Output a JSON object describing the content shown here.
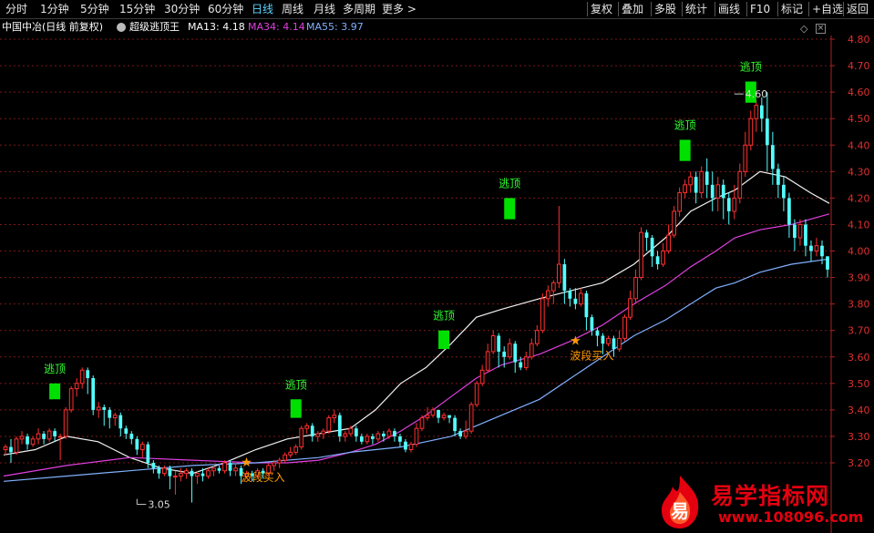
{
  "toolbar": {
    "left": [
      "分时",
      "1分钟",
      "5分钟",
      "15分钟",
      "30分钟",
      "60分钟",
      "日线",
      "周线",
      "月线",
      "多周期",
      "更多 >"
    ],
    "active": "日线",
    "right": [
      "复权",
      "叠加",
      "多股",
      "统计",
      "画线",
      "F10",
      "标记",
      "+自选",
      "返回"
    ]
  },
  "info": {
    "title": "中国中冶(日线 前复权)",
    "indicator": "超级逃顶王",
    "ma13": "MA13: 4.18",
    "ma34": "MA34: 4.14",
    "ma55": "MA55: 3.97",
    "ma13_color": "#ffffff",
    "ma34_color": "#e040e0",
    "ma55_color": "#80b0ff"
  },
  "watermark": {
    "title": "易学指标网",
    "url": "www.108096.com",
    "logo_char": "易",
    "color": "#e50010"
  },
  "chart_data": {
    "type": "candlestick",
    "ylim": [
      3.14,
      4.86
    ],
    "y_ticks": [
      "4.80",
      "4.70",
      "4.60",
      "4.50",
      "4.40",
      "4.30",
      "4.20",
      "4.10",
      "4.00",
      "3.90",
      "3.80",
      "3.70",
      "3.60",
      "3.50",
      "3.40",
      "3.30",
      "3.20"
    ],
    "grid": true,
    "up_color": "#ff3030",
    "down_color": "#54ffff",
    "candles": [
      [
        3.25,
        3.26,
        3.23,
        3.27
      ],
      [
        3.26,
        3.24,
        3.2,
        3.29
      ],
      [
        3.24,
        3.29,
        3.23,
        3.3
      ],
      [
        3.29,
        3.3,
        3.27,
        3.32
      ],
      [
        3.3,
        3.27,
        3.25,
        3.31
      ],
      [
        3.27,
        3.29,
        3.26,
        3.3
      ],
      [
        3.29,
        3.31,
        3.27,
        3.33
      ],
      [
        3.31,
        3.29,
        3.27,
        3.32
      ],
      [
        3.29,
        3.32,
        3.28,
        3.33
      ],
      [
        3.32,
        3.3,
        3.28,
        3.33
      ],
      [
        3.3,
        3.3,
        3.21,
        3.31
      ],
      [
        3.3,
        3.4,
        3.29,
        3.41
      ],
      [
        3.4,
        3.48,
        3.39,
        3.49
      ],
      [
        3.48,
        3.5,
        3.45,
        3.52
      ],
      [
        3.5,
        3.55,
        3.48,
        3.56
      ],
      [
        3.55,
        3.52,
        3.46,
        3.56
      ],
      [
        3.52,
        3.4,
        3.38,
        3.53
      ],
      [
        3.4,
        3.41,
        3.37,
        3.43
      ],
      [
        3.41,
        3.4,
        3.34,
        3.42
      ],
      [
        3.4,
        3.37,
        3.33,
        3.41
      ],
      [
        3.37,
        3.38,
        3.34,
        3.39
      ],
      [
        3.38,
        3.33,
        3.3,
        3.39
      ],
      [
        3.33,
        3.31,
        3.29,
        3.34
      ],
      [
        3.31,
        3.29,
        3.27,
        3.32
      ],
      [
        3.29,
        3.25,
        3.23,
        3.3
      ],
      [
        3.25,
        3.27,
        3.22,
        3.28
      ],
      [
        3.27,
        3.2,
        3.18,
        3.28
      ],
      [
        3.2,
        3.18,
        3.16,
        3.21
      ],
      [
        3.18,
        3.16,
        3.14,
        3.19
      ],
      [
        3.16,
        3.18,
        3.15,
        3.19
      ],
      [
        3.18,
        3.15,
        3.1,
        3.19
      ],
      [
        3.15,
        3.15,
        3.08,
        3.17
      ],
      [
        3.15,
        3.16,
        3.13,
        3.18
      ],
      [
        3.16,
        3.17,
        3.14,
        3.18
      ],
      [
        3.17,
        3.15,
        3.05,
        3.18
      ],
      [
        3.15,
        3.16,
        3.12,
        3.17
      ],
      [
        3.16,
        3.15,
        3.13,
        3.18
      ],
      [
        3.15,
        3.17,
        3.14,
        3.18
      ],
      [
        3.17,
        3.18,
        3.15,
        3.19
      ],
      [
        3.18,
        3.17,
        3.16,
        3.19
      ],
      [
        3.17,
        3.2,
        3.16,
        3.21
      ],
      [
        3.2,
        3.17,
        3.15,
        3.21
      ],
      [
        3.17,
        3.18,
        3.15,
        3.2
      ],
      [
        3.18,
        3.15,
        3.12,
        3.19
      ],
      [
        3.15,
        3.16,
        3.14,
        3.17
      ],
      [
        3.16,
        3.15,
        3.13,
        3.17
      ],
      [
        3.15,
        3.17,
        3.14,
        3.18
      ],
      [
        3.17,
        3.16,
        3.14,
        3.18
      ],
      [
        3.16,
        3.19,
        3.15,
        3.2
      ],
      [
        3.19,
        3.2,
        3.17,
        3.21
      ],
      [
        3.2,
        3.21,
        3.18,
        3.22
      ],
      [
        3.21,
        3.23,
        3.2,
        3.24
      ],
      [
        3.23,
        3.24,
        3.22,
        3.26
      ],
      [
        3.24,
        3.26,
        3.23,
        3.27
      ],
      [
        3.26,
        3.33,
        3.25,
        3.34
      ],
      [
        3.33,
        3.34,
        3.31,
        3.35
      ],
      [
        3.34,
        3.3,
        3.28,
        3.35
      ],
      [
        3.3,
        3.31,
        3.28,
        3.32
      ],
      [
        3.31,
        3.32,
        3.29,
        3.33
      ],
      [
        3.32,
        3.37,
        3.31,
        3.38
      ],
      [
        3.37,
        3.38,
        3.35,
        3.4
      ],
      [
        3.38,
        3.3,
        3.28,
        3.39
      ],
      [
        3.3,
        3.31,
        3.28,
        3.32
      ],
      [
        3.31,
        3.33,
        3.3,
        3.34
      ],
      [
        3.33,
        3.3,
        3.28,
        3.34
      ],
      [
        3.3,
        3.28,
        3.27,
        3.31
      ],
      [
        3.28,
        3.3,
        3.27,
        3.31
      ],
      [
        3.3,
        3.29,
        3.27,
        3.31
      ],
      [
        3.29,
        3.31,
        3.28,
        3.32
      ],
      [
        3.31,
        3.3,
        3.28,
        3.32
      ],
      [
        3.3,
        3.32,
        3.29,
        3.33
      ],
      [
        3.32,
        3.3,
        3.28,
        3.33
      ],
      [
        3.3,
        3.28,
        3.26,
        3.31
      ],
      [
        3.28,
        3.25,
        3.24,
        3.29
      ],
      [
        3.25,
        3.27,
        3.24,
        3.28
      ],
      [
        3.27,
        3.33,
        3.26,
        3.35
      ],
      [
        3.33,
        3.37,
        3.32,
        3.38
      ],
      [
        3.37,
        3.38,
        3.36,
        3.41
      ],
      [
        3.38,
        3.4,
        3.37,
        3.41
      ],
      [
        3.4,
        3.37,
        3.35,
        3.4
      ],
      [
        3.37,
        3.38,
        3.36,
        3.39
      ],
      [
        3.38,
        3.37,
        3.35,
        3.38
      ],
      [
        3.37,
        3.32,
        3.3,
        3.38
      ],
      [
        3.32,
        3.3,
        3.29,
        3.33
      ],
      [
        3.3,
        3.32,
        3.29,
        3.36
      ],
      [
        3.32,
        3.42,
        3.31,
        3.43
      ],
      [
        3.42,
        3.5,
        3.41,
        3.51
      ],
      [
        3.5,
        3.55,
        3.49,
        3.57
      ],
      [
        3.55,
        3.62,
        3.54,
        3.65
      ],
      [
        3.62,
        3.68,
        3.61,
        3.7
      ],
      [
        3.68,
        3.62,
        3.56,
        3.69
      ],
      [
        3.62,
        3.6,
        3.56,
        3.64
      ],
      [
        3.6,
        3.65,
        3.59,
        3.67
      ],
      [
        3.65,
        3.58,
        3.54,
        3.66
      ],
      [
        3.58,
        3.56,
        3.55,
        3.6
      ],
      [
        3.56,
        3.6,
        3.55,
        3.62
      ],
      [
        3.6,
        3.65,
        3.59,
        3.67
      ],
      [
        3.65,
        3.7,
        3.64,
        3.72
      ],
      [
        3.7,
        3.82,
        3.69,
        3.84
      ],
      [
        3.82,
        3.85,
        3.79,
        3.87
      ],
      [
        3.85,
        3.88,
        3.8,
        3.89
      ],
      [
        3.88,
        3.95,
        3.86,
        4.17
      ],
      [
        3.95,
        3.85,
        3.8,
        3.97
      ],
      [
        3.85,
        3.82,
        3.79,
        3.86
      ],
      [
        3.82,
        3.8,
        3.78,
        3.86
      ],
      [
        3.8,
        3.84,
        3.79,
        3.86
      ],
      [
        3.84,
        3.75,
        3.7,
        3.85
      ],
      [
        3.75,
        3.7,
        3.68,
        3.76
      ],
      [
        3.7,
        3.68,
        3.64,
        3.71
      ],
      [
        3.68,
        3.65,
        3.61,
        3.69
      ],
      [
        3.65,
        3.67,
        3.64,
        3.68
      ],
      [
        3.67,
        3.63,
        3.6,
        3.68
      ],
      [
        3.63,
        3.67,
        3.62,
        3.7
      ],
      [
        3.67,
        3.75,
        3.66,
        3.76
      ],
      [
        3.75,
        3.82,
        3.74,
        3.85
      ],
      [
        3.82,
        3.9,
        3.8,
        3.93
      ],
      [
        3.9,
        4.07,
        3.89,
        4.09
      ],
      [
        4.07,
        4.05,
        4.0,
        4.08
      ],
      [
        4.05,
        3.98,
        3.94,
        4.06
      ],
      [
        3.98,
        3.95,
        3.93,
        4.0
      ],
      [
        3.95,
        4.0,
        3.94,
        4.03
      ],
      [
        4.0,
        4.06,
        3.99,
        4.1
      ],
      [
        4.06,
        4.15,
        4.05,
        4.17
      ],
      [
        4.15,
        4.22,
        4.13,
        4.24
      ],
      [
        4.22,
        4.25,
        4.2,
        4.27
      ],
      [
        4.25,
        4.28,
        4.22,
        4.3
      ],
      [
        4.28,
        4.22,
        4.18,
        4.3
      ],
      [
        4.22,
        4.3,
        4.2,
        4.32
      ],
      [
        4.3,
        4.25,
        4.2,
        4.35
      ],
      [
        4.25,
        4.2,
        4.15,
        4.3
      ],
      [
        4.2,
        4.25,
        4.15,
        4.28
      ],
      [
        4.25,
        4.2,
        4.12,
        4.27
      ],
      [
        4.2,
        4.15,
        4.1,
        4.22
      ],
      [
        4.15,
        4.2,
        4.12,
        4.25
      ],
      [
        4.2,
        4.3,
        4.18,
        4.33
      ],
      [
        4.3,
        4.4,
        4.28,
        4.45
      ],
      [
        4.4,
        4.5,
        4.38,
        4.53
      ],
      [
        4.5,
        4.55,
        4.45,
        4.57
      ],
      [
        4.55,
        4.5,
        4.45,
        4.58
      ],
      [
        4.5,
        4.4,
        4.3,
        4.6
      ],
      [
        4.4,
        4.31,
        4.25,
        4.45
      ],
      [
        4.31,
        4.25,
        4.2,
        4.33
      ],
      [
        4.25,
        4.2,
        4.15,
        4.28
      ],
      [
        4.2,
        4.1,
        4.05,
        4.22
      ],
      [
        4.1,
        4.05,
        4.0,
        4.12
      ],
      [
        4.05,
        4.1,
        4.02,
        4.12
      ],
      [
        4.1,
        4.02,
        3.98,
        4.12
      ],
      [
        4.02,
        4.0,
        3.96,
        4.04
      ],
      [
        4.0,
        4.02,
        3.98,
        4.05
      ],
      [
        4.02,
        3.98,
        3.95,
        4.04
      ],
      [
        3.98,
        3.93,
        3.9,
        3.98
      ]
    ],
    "ma_lines": [
      {
        "name": "MA13",
        "color": "#f0f0f0",
        "points": [
          [
            0,
            3.23
          ],
          [
            10,
            3.25
          ],
          [
            20,
            3.3
          ],
          [
            30,
            3.28
          ],
          [
            40,
            3.22
          ],
          [
            50,
            3.18
          ],
          [
            60,
            3.16
          ],
          [
            70,
            3.2
          ],
          [
            80,
            3.25
          ],
          [
            90,
            3.29
          ],
          [
            100,
            3.31
          ],
          [
            110,
            3.33
          ],
          [
            118,
            3.4
          ],
          [
            126,
            3.5
          ],
          [
            134,
            3.56
          ],
          [
            142,
            3.65
          ],
          [
            150,
            3.75
          ],
          [
            158,
            3.78
          ],
          [
            170,
            3.82
          ],
          [
            180,
            3.85
          ],
          [
            190,
            3.88
          ],
          [
            200,
            3.95
          ],
          [
            210,
            4.05
          ],
          [
            218,
            4.15
          ],
          [
            226,
            4.2
          ],
          [
            232,
            4.23
          ],
          [
            240,
            4.3
          ],
          [
            248,
            4.28
          ],
          [
            256,
            4.22
          ],
          [
            262,
            4.18
          ]
        ]
      },
      {
        "name": "MA34",
        "color": "#e040e0",
        "points": [
          [
            0,
            3.15
          ],
          [
            20,
            3.19
          ],
          [
            40,
            3.22
          ],
          [
            60,
            3.21
          ],
          [
            80,
            3.2
          ],
          [
            90,
            3.2
          ],
          [
            100,
            3.21
          ],
          [
            110,
            3.24
          ],
          [
            118,
            3.27
          ],
          [
            126,
            3.32
          ],
          [
            134,
            3.38
          ],
          [
            142,
            3.45
          ],
          [
            150,
            3.52
          ],
          [
            158,
            3.57
          ],
          [
            170,
            3.61
          ],
          [
            180,
            3.66
          ],
          [
            190,
            3.72
          ],
          [
            200,
            3.8
          ],
          [
            210,
            3.87
          ],
          [
            218,
            3.94
          ],
          [
            226,
            4.0
          ],
          [
            232,
            4.05
          ],
          [
            240,
            4.08
          ],
          [
            250,
            4.1
          ],
          [
            262,
            4.14
          ]
        ]
      },
      {
        "name": "MA55",
        "color": "#80b0ff",
        "points": [
          [
            0,
            3.13
          ],
          [
            20,
            3.15
          ],
          [
            40,
            3.17
          ],
          [
            60,
            3.19
          ],
          [
            80,
            3.2
          ],
          [
            100,
            3.22
          ],
          [
            110,
            3.24
          ],
          [
            118,
            3.25
          ],
          [
            126,
            3.26
          ],
          [
            134,
            3.28
          ],
          [
            142,
            3.3
          ],
          [
            150,
            3.34
          ],
          [
            158,
            3.38
          ],
          [
            170,
            3.44
          ],
          [
            180,
            3.52
          ],
          [
            190,
            3.6
          ],
          [
            200,
            3.68
          ],
          [
            210,
            3.74
          ],
          [
            218,
            3.8
          ],
          [
            226,
            3.86
          ],
          [
            232,
            3.88
          ],
          [
            240,
            3.92
          ],
          [
            250,
            3.95
          ],
          [
            262,
            3.97
          ]
        ]
      }
    ],
    "escape_signals": [
      {
        "index": 15,
        "top": 3.5,
        "bottom": 3.44,
        "label": "逃顶"
      },
      {
        "index": 92,
        "top": 3.44,
        "bottom": 3.37,
        "label": "逃顶"
      },
      {
        "index": 139,
        "top": 3.7,
        "bottom": 3.63,
        "label": "逃顶"
      },
      {
        "index": 160,
        "top": 4.2,
        "bottom": 4.12,
        "label": "逃顶"
      },
      {
        "index": 216,
        "top": 4.42,
        "bottom": 4.34,
        "label": "逃顶"
      },
      {
        "index": 238,
        "top": 4.64,
        "bottom": 4.56,
        "label": "逃顶"
      }
    ],
    "buy_signals": [
      {
        "index": 76,
        "value": 3.2,
        "label": "波段买入"
      },
      {
        "index": 181,
        "value": 3.66,
        "label": "波段买入"
      }
    ],
    "annotations": [
      {
        "text": "3.05",
        "index": 42,
        "value": 3.05,
        "type": "low"
      },
      {
        "text": "4.60",
        "index": 234,
        "value": 4.6,
        "type": "high"
      }
    ]
  }
}
